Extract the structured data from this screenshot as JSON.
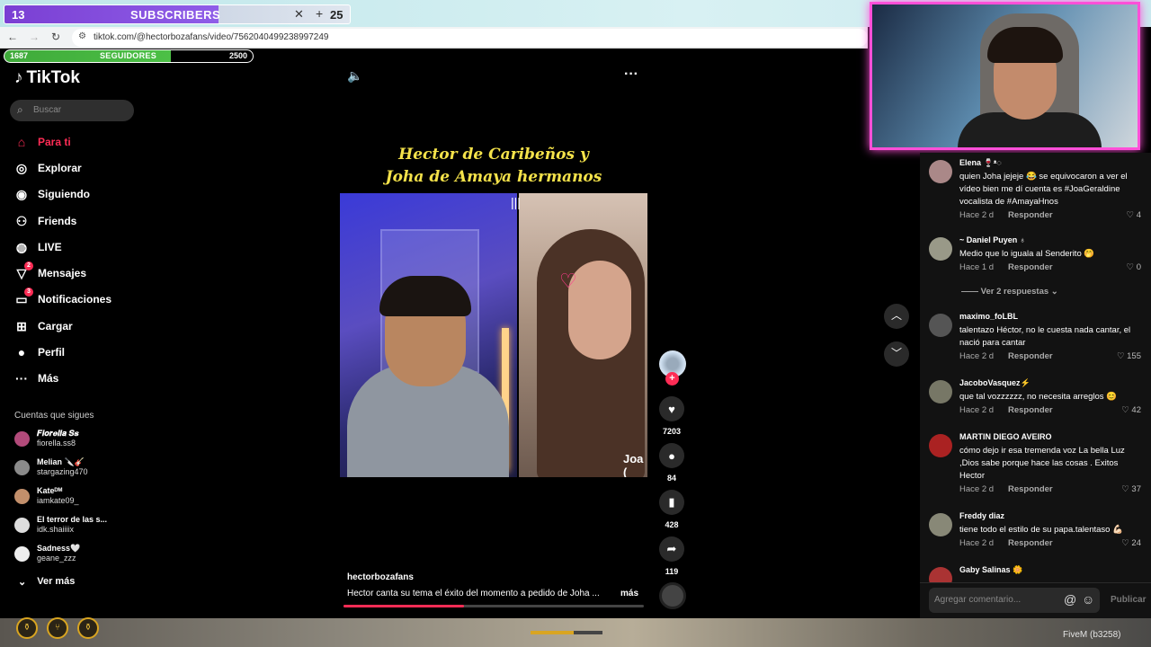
{
  "overlay": {
    "subscribers": {
      "current": "13",
      "label": "SUBSCRIBERS",
      "goal": "25",
      "progress": 0.52
    },
    "followers": {
      "current": "1687",
      "label": "SEGUIDORES",
      "goal": "2500",
      "progress": 0.67
    },
    "fivem_label": "FiveM (b3258)"
  },
  "browser": {
    "url": "tiktok.com/@hectorbozafans/video/7562040499238997249"
  },
  "sidebar": {
    "logo": "TikTok",
    "search_placeholder": "Buscar",
    "nav": [
      {
        "label": "Para ti",
        "icon": "home-icon"
      },
      {
        "label": "Explorar",
        "icon": "compass-icon"
      },
      {
        "label": "Siguiendo",
        "icon": "following-icon"
      },
      {
        "label": "Friends",
        "icon": "friends-icon"
      },
      {
        "label": "LIVE",
        "icon": "live-icon"
      },
      {
        "label": "Mensajes",
        "icon": "messages-icon",
        "badge": "2"
      },
      {
        "label": "Notificaciones",
        "icon": "notifications-icon",
        "badge": "3"
      },
      {
        "label": "Cargar",
        "icon": "upload-icon"
      },
      {
        "label": "Perfil",
        "icon": "profile-icon"
      },
      {
        "label": "Más",
        "icon": "more-icon"
      }
    ],
    "following_title": "Cuentas que sigues",
    "accounts": [
      {
        "name": "𝑭𝒊𝒐𝒓𝒆𝒍𝒍𝒂 𝑺𝒔",
        "handle": "fiorella.ss8"
      },
      {
        "name": "Melian 🔪🎸",
        "handle": "stargazing470"
      },
      {
        "name": "Kateᴰᴹ",
        "handle": "iamkate09_"
      },
      {
        "name": "El terror de las s...",
        "handle": "idk.shaiiiix"
      },
      {
        "name": "Sadness🤍",
        "handle": "geane_zzz"
      }
    ],
    "see_more": "Ver más"
  },
  "video": {
    "title_line1": "Hector de Caribeños y",
    "title_line2": "Joha de Amaya hermanos",
    "overlay_name": "Joa (",
    "author": "hectorbozafans",
    "description": "Hector canta su tema el éxito del momento a pedido de Joha ...",
    "more": "más",
    "progress": 0.4,
    "likes": "7203",
    "comments": "84",
    "saves": "428",
    "shares": "119"
  },
  "comments": [
    {
      "user": "Elena 🍷ᵜ◌",
      "text": "quien Joha jejeje 😂 se equivocaron a ver el vídeo bien me dí cuenta es #JoaGeraldine vocalista de #AmayaHnos",
      "time": "Hace 2 d",
      "reply": "Responder",
      "likes": "4"
    },
    {
      "user": "~ Daniel Puyen ♁",
      "text": "Medio que lo iguala al Senderito 🤭",
      "time": "Hace 1 d",
      "reply": "Responder",
      "likes": "0"
    },
    {
      "user": "maximo_foLBL",
      "text": "talentazo Héctor, no le cuesta nada cantar, el nació para cantar",
      "time": "Hace 2 d",
      "reply": "Responder",
      "likes": "155"
    },
    {
      "user": "JacoboVasquez⚡",
      "text": "que tal vozzzzzz, no necesita arreglos 😊",
      "time": "Hace 2 d",
      "reply": "Responder",
      "likes": "42"
    },
    {
      "user": "MARTIN DIEGO AVEIRO",
      "text": "cómo dejo ir esa tremenda voz La bella Luz ,Dios sabe porque hace las cosas . Exitos Hector",
      "time": "Hace 2 d",
      "reply": "Responder",
      "likes": "37"
    },
    {
      "user": "Freddy diaz",
      "text": "tiene todo el estilo de su papa.talentaso 💪🏻",
      "time": "Hace 2 d",
      "reply": "Responder",
      "likes": "24"
    },
    {
      "user": "Gaby Salinas 🌼",
      "text": "",
      "time": "",
      "reply": "",
      "likes": ""
    }
  ],
  "view_replies": "Ver 2 respuestas",
  "comment_box": {
    "placeholder": "Agregar comentario...",
    "publish": "Publicar"
  },
  "colors": {
    "accent": "#fe2c55",
    "sub_bar": "#8f5ee8",
    "follow_bar": "#4cc046",
    "cam_border": "#ff4fd8"
  }
}
